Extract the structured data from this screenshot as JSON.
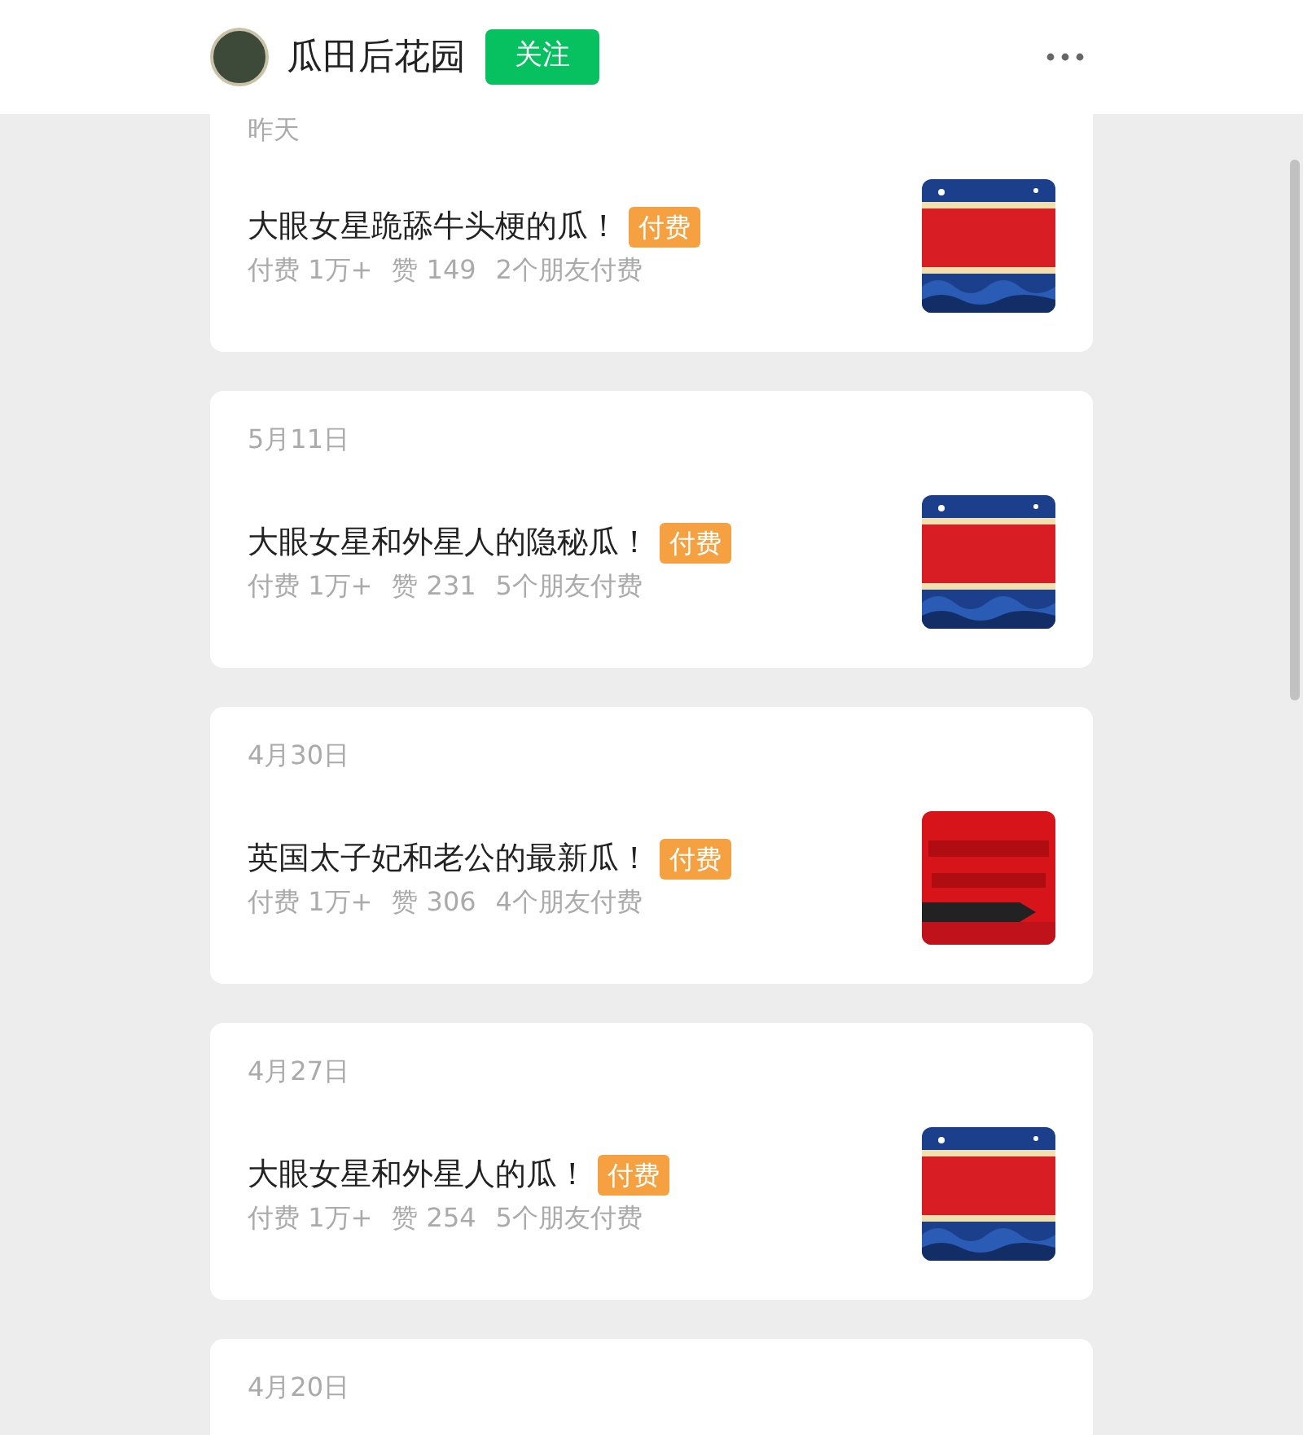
{
  "header": {
    "title": "瓜田后花园",
    "follow_button": "关注"
  },
  "articles": [
    {
      "date": "昨天",
      "title": "大眼女星跪舔牛头梗的瓜！",
      "badge": "付费",
      "paid": "付费 1万+",
      "likes": "赞 149",
      "friends": "2个朋友付费"
    },
    {
      "date": "5月11日",
      "title": "大眼女星和外星人的隐秘瓜！",
      "badge": "付费",
      "paid": "付费 1万+",
      "likes": "赞 231",
      "friends": "5个朋友付费"
    },
    {
      "date": "4月30日",
      "title": "英国太子妃和老公的最新瓜！",
      "badge": "付费",
      "paid": "付费 1万+",
      "likes": "赞 306",
      "friends": "4个朋友付费"
    },
    {
      "date": "4月27日",
      "title": "大眼女星和外星人的瓜！",
      "badge": "付费",
      "paid": "付费 1万+",
      "likes": "赞 254",
      "friends": "5个朋友付费"
    },
    {
      "date": "4月20日"
    }
  ]
}
